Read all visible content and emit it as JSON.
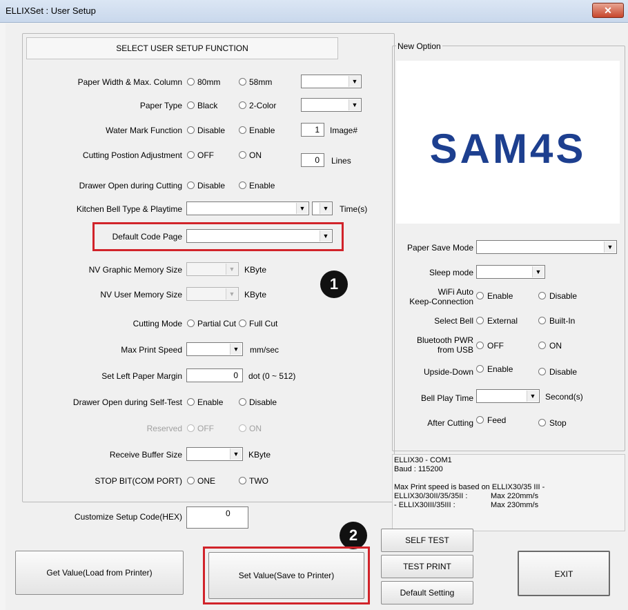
{
  "window": {
    "title": "ELLIXSet : User Setup",
    "close_glyph": "✕"
  },
  "header": {
    "label": "SELECT USER SETUP FUNCTION"
  },
  "left": {
    "paper_width": {
      "label": "Paper Width & Max. Column",
      "opt1": "80mm",
      "opt2": "58mm"
    },
    "paper_type": {
      "label": "Paper Type",
      "opt1": "Black",
      "opt2": "2-Color"
    },
    "water_mark": {
      "label": "Water Mark Function",
      "opt1": "Disable",
      "opt2": "Enable",
      "value": "1",
      "unit": "Image#"
    },
    "cutting_pos": {
      "label": "Cutting Postion Adjustment",
      "opt1": "OFF",
      "opt2": "ON",
      "value": "0",
      "unit": "Lines"
    },
    "drawer_cut": {
      "label": "Drawer Open during Cutting",
      "opt1": "Disable",
      "opt2": "Enable"
    },
    "kitchen_bell": {
      "label": "Kitchen Bell Type & Playtime",
      "unit": "Time(s)"
    },
    "code_page": {
      "label": "Default Code Page"
    },
    "nv_graphic": {
      "label": "NV Graphic Memory Size",
      "unit": "KByte"
    },
    "nv_user": {
      "label": "NV User Memory Size",
      "unit": "KByte"
    },
    "cutting_mode": {
      "label": "Cutting Mode",
      "opt1": "Partial Cut",
      "opt2": "Full Cut"
    },
    "max_speed": {
      "label": "Max Print Speed",
      "unit": "mm/sec"
    },
    "left_margin": {
      "label": "Set Left Paper Margin",
      "value": "0",
      "unit": "dot (0 ~ 512)"
    },
    "drawer_self": {
      "label": "Drawer Open during Self-Test",
      "opt1": "Enable",
      "opt2": "Disable"
    },
    "reserved": {
      "label": "Reserved",
      "opt1": "OFF",
      "opt2": "ON"
    },
    "rx_buffer": {
      "label": "Receive Buffer Size",
      "unit": "KByte"
    },
    "stop_bit": {
      "label": "STOP BIT(COM PORT)",
      "opt1": "ONE",
      "opt2": "TWO"
    }
  },
  "customize": {
    "label": "Customize Setup Code(HEX)",
    "value": "0"
  },
  "new_option": {
    "title": "New Option",
    "logo": "SAM4S",
    "paper_save": {
      "label": "Paper Save Mode"
    },
    "sleep": {
      "label": "Sleep mode"
    },
    "wifi": {
      "label1": "WiFi Auto",
      "label2": "Keep-Connection",
      "opt1": "Enable",
      "opt2": "Disable"
    },
    "select_bell": {
      "label": "Select Bell",
      "opt1": "External",
      "opt2": "Built-In"
    },
    "bt_pwr": {
      "label1": "Bluetooth PWR",
      "label2": "from USB",
      "opt1": "OFF",
      "opt2": "ON"
    },
    "upside": {
      "label": "Upside-Down",
      "opt1": "Enable",
      "opt2": "Disable"
    },
    "bell_time": {
      "label": "Bell Play Time",
      "unit": "Second(s)"
    },
    "after_cut": {
      "label": "After Cutting",
      "opt1": "Feed",
      "opt2": "Stop"
    }
  },
  "info": {
    "line1": "ELLIX30 - COM1",
    "line2": "Baud : 115200",
    "line3": "Max Print speed is based on ELLIX30/35 III -",
    "line4a": "ELLIX30/30II/35/35II :",
    "line4b": "Max 220mm/s",
    "line5a": "- ELLIX30III/35III :",
    "line5b": "Max 230mm/s"
  },
  "annotations": {
    "one": "1",
    "two": "2"
  },
  "buttons": {
    "get_value": "Get Value(Load from Printer)",
    "set_value": "Set Value(Save to Printer)",
    "self_test": "SELF TEST",
    "test_print": "TEST PRINT",
    "default_setting": "Default Setting",
    "exit": "EXIT"
  },
  "colors": {
    "highlight": "#d1232a",
    "logo": "#1d3f8f"
  }
}
